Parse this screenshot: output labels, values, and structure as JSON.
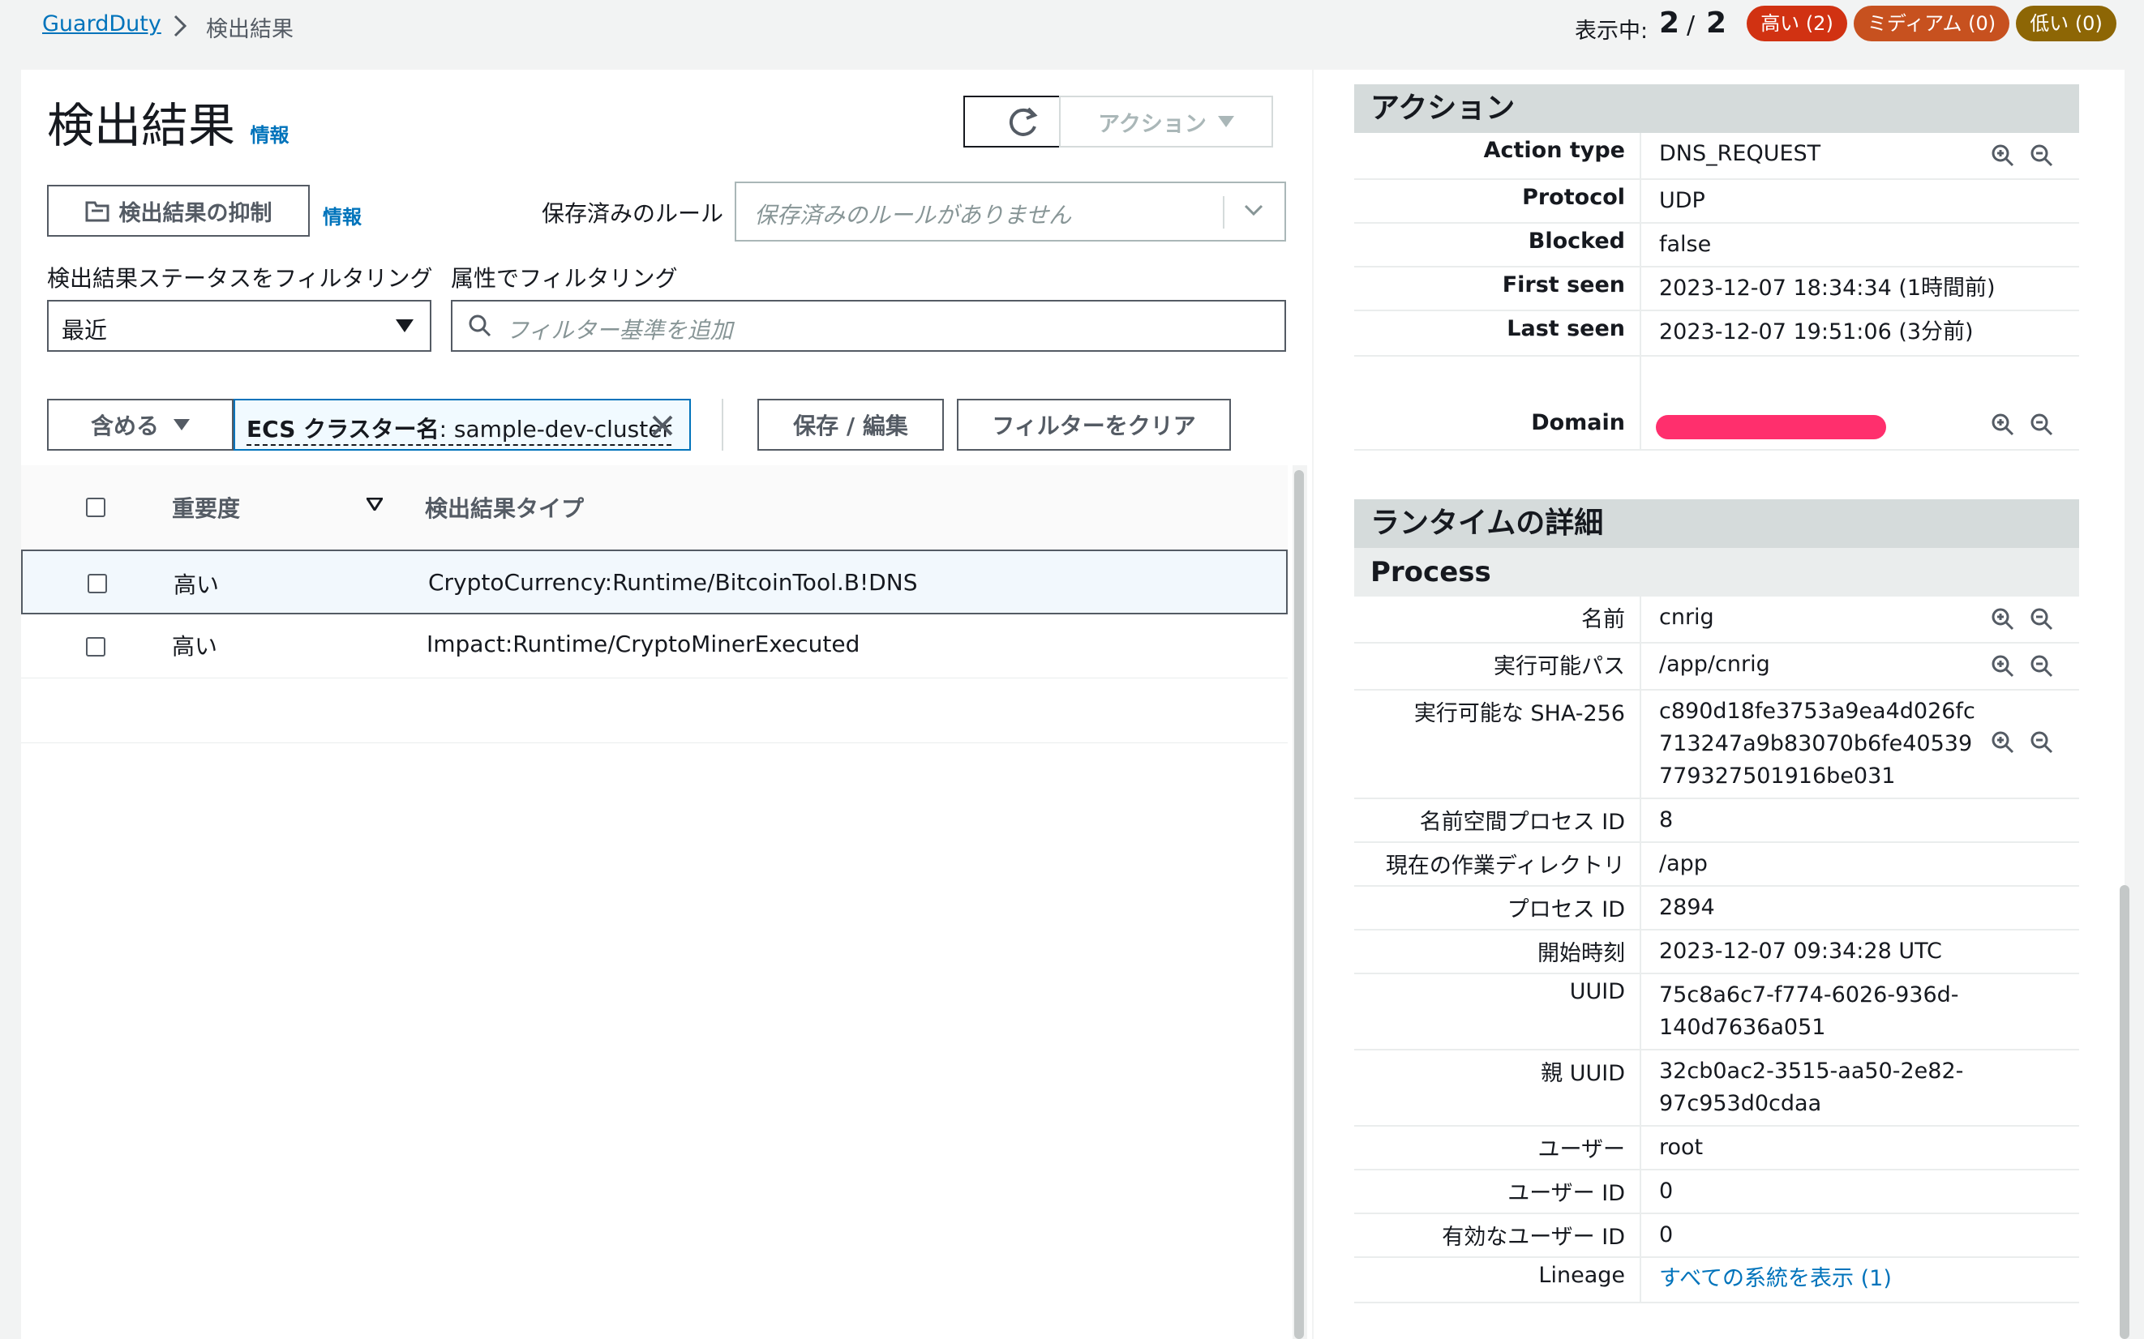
{
  "breadcrumb": {
    "root": "GuardDuty",
    "current": "検出結果"
  },
  "counter": {
    "label": "表示中:",
    "shown": "2",
    "slash": "/",
    "total": "2"
  },
  "badges": {
    "high": "高い (2)",
    "medium": "ミディアム (0)",
    "low": "低い (0)"
  },
  "page": {
    "title": "検出結果",
    "info": "情報"
  },
  "toolbar": {
    "actions": "アクション",
    "suppress": "検出結果の抑制",
    "suppress_info": "情報"
  },
  "saved_rules": {
    "label": "保存済みのルール",
    "placeholder": "保存済みのルールがありません"
  },
  "filters": {
    "status_label": "検出結果ステータスをフィルタリング",
    "status_value": "最近",
    "attr_label": "属性でフィルタリング",
    "attr_placeholder": "フィルター基準を追加",
    "include": "含める",
    "token_key": "ECS クラスター名",
    "token_value": ": sample-dev-cluster",
    "save": "保存 / 編集",
    "clear": "フィルターをクリア"
  },
  "table": {
    "headers": {
      "severity": "重要度",
      "type": "検出結果タイプ"
    },
    "rows": [
      {
        "severity": "高い",
        "type": "CryptoCurrency:Runtime/BitcoinTool.B!DNS"
      },
      {
        "severity": "高い",
        "type": "Impact:Runtime/CryptoMinerExecuted"
      }
    ]
  },
  "details": {
    "action_header": "アクション",
    "action": [
      {
        "key": "Action type",
        "value": "DNS_REQUEST"
      },
      {
        "key": "Protocol",
        "value": "UDP"
      },
      {
        "key": "Blocked",
        "value": "false"
      },
      {
        "key": "First seen",
        "value": "2023-12-07 18:34:34 (1時間前)"
      },
      {
        "key": "Last seen",
        "value": "2023-12-07 19:51:06 (3分前)"
      },
      {
        "key": "Domain",
        "value": ""
      }
    ],
    "runtime_header": "ランタイムの詳細",
    "process_header": "Process",
    "process": [
      {
        "key": "名前",
        "value": "cnrig"
      },
      {
        "key": "実行可能パス",
        "value": "/app/cnrig"
      },
      {
        "key": "実行可能な SHA-256",
        "value": "c890d18fe3753a9ea4d026fc\n713247a9b83070b6fe40539\n779327501916be031"
      },
      {
        "key": "名前空間プロセス ID",
        "value": "8"
      },
      {
        "key": "現在の作業ディレクトリ",
        "value": "/app"
      },
      {
        "key": "プロセス ID",
        "value": "2894"
      },
      {
        "key": "開始時刻",
        "value": "2023-12-07 09:34:28 UTC"
      },
      {
        "key": "UUID",
        "value": "75c8a6c7-f774-6026-936d-\n140d7636a051"
      },
      {
        "key": "親 UUID",
        "value": "32cb0ac2-3515-aa50-2e82-\n97c953d0cdaa"
      },
      {
        "key": "ユーザー",
        "value": "root"
      },
      {
        "key": "ユーザー ID",
        "value": "0"
      },
      {
        "key": "有効なユーザー ID",
        "value": "0"
      },
      {
        "key": "Lineage",
        "value": "すべての系統を表示 (1)"
      }
    ]
  },
  "colors": {
    "link": "#0073bb",
    "high": "#d13212",
    "medium": "#c7511f",
    "low": "#8d6605",
    "redaction": "#ff2f6d"
  }
}
